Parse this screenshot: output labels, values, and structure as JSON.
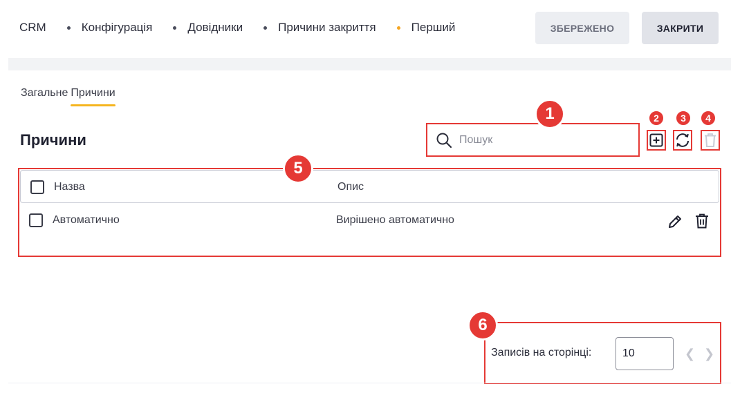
{
  "breadcrumb": {
    "items": [
      {
        "label": "CRM"
      },
      {
        "label": "Конфігурація"
      },
      {
        "label": "Довідники"
      },
      {
        "label": "Причини закриття"
      },
      {
        "label": "Перший"
      }
    ]
  },
  "toolbar": {
    "saved_label": "ЗБЕРЕЖЕНО",
    "close_label": "ЗАКРИТИ"
  },
  "tabs": [
    {
      "label": "Загальне",
      "active": false
    },
    {
      "label": "Причини",
      "active": true
    }
  ],
  "section": {
    "title": "Причини"
  },
  "search": {
    "placeholder": "Пошук",
    "icon": "search-icon"
  },
  "actions": {
    "add_icon": "plus-square-icon",
    "refresh_icon": "refresh-icon",
    "delete_icon": "trash-icon"
  },
  "table": {
    "columns": [
      "Назва",
      "Опис"
    ],
    "rows": [
      {
        "name": "Автоматично",
        "description": "Вирішено автоматично"
      }
    ]
  },
  "pagination": {
    "label": "Записів на сторінці:",
    "page_size": "10"
  },
  "annotations": [
    "1",
    "2",
    "3",
    "4",
    "5",
    "6"
  ],
  "colors": {
    "accent": "#f5b51f",
    "annotation": "#e53935",
    "text": "#2b2d3a"
  }
}
